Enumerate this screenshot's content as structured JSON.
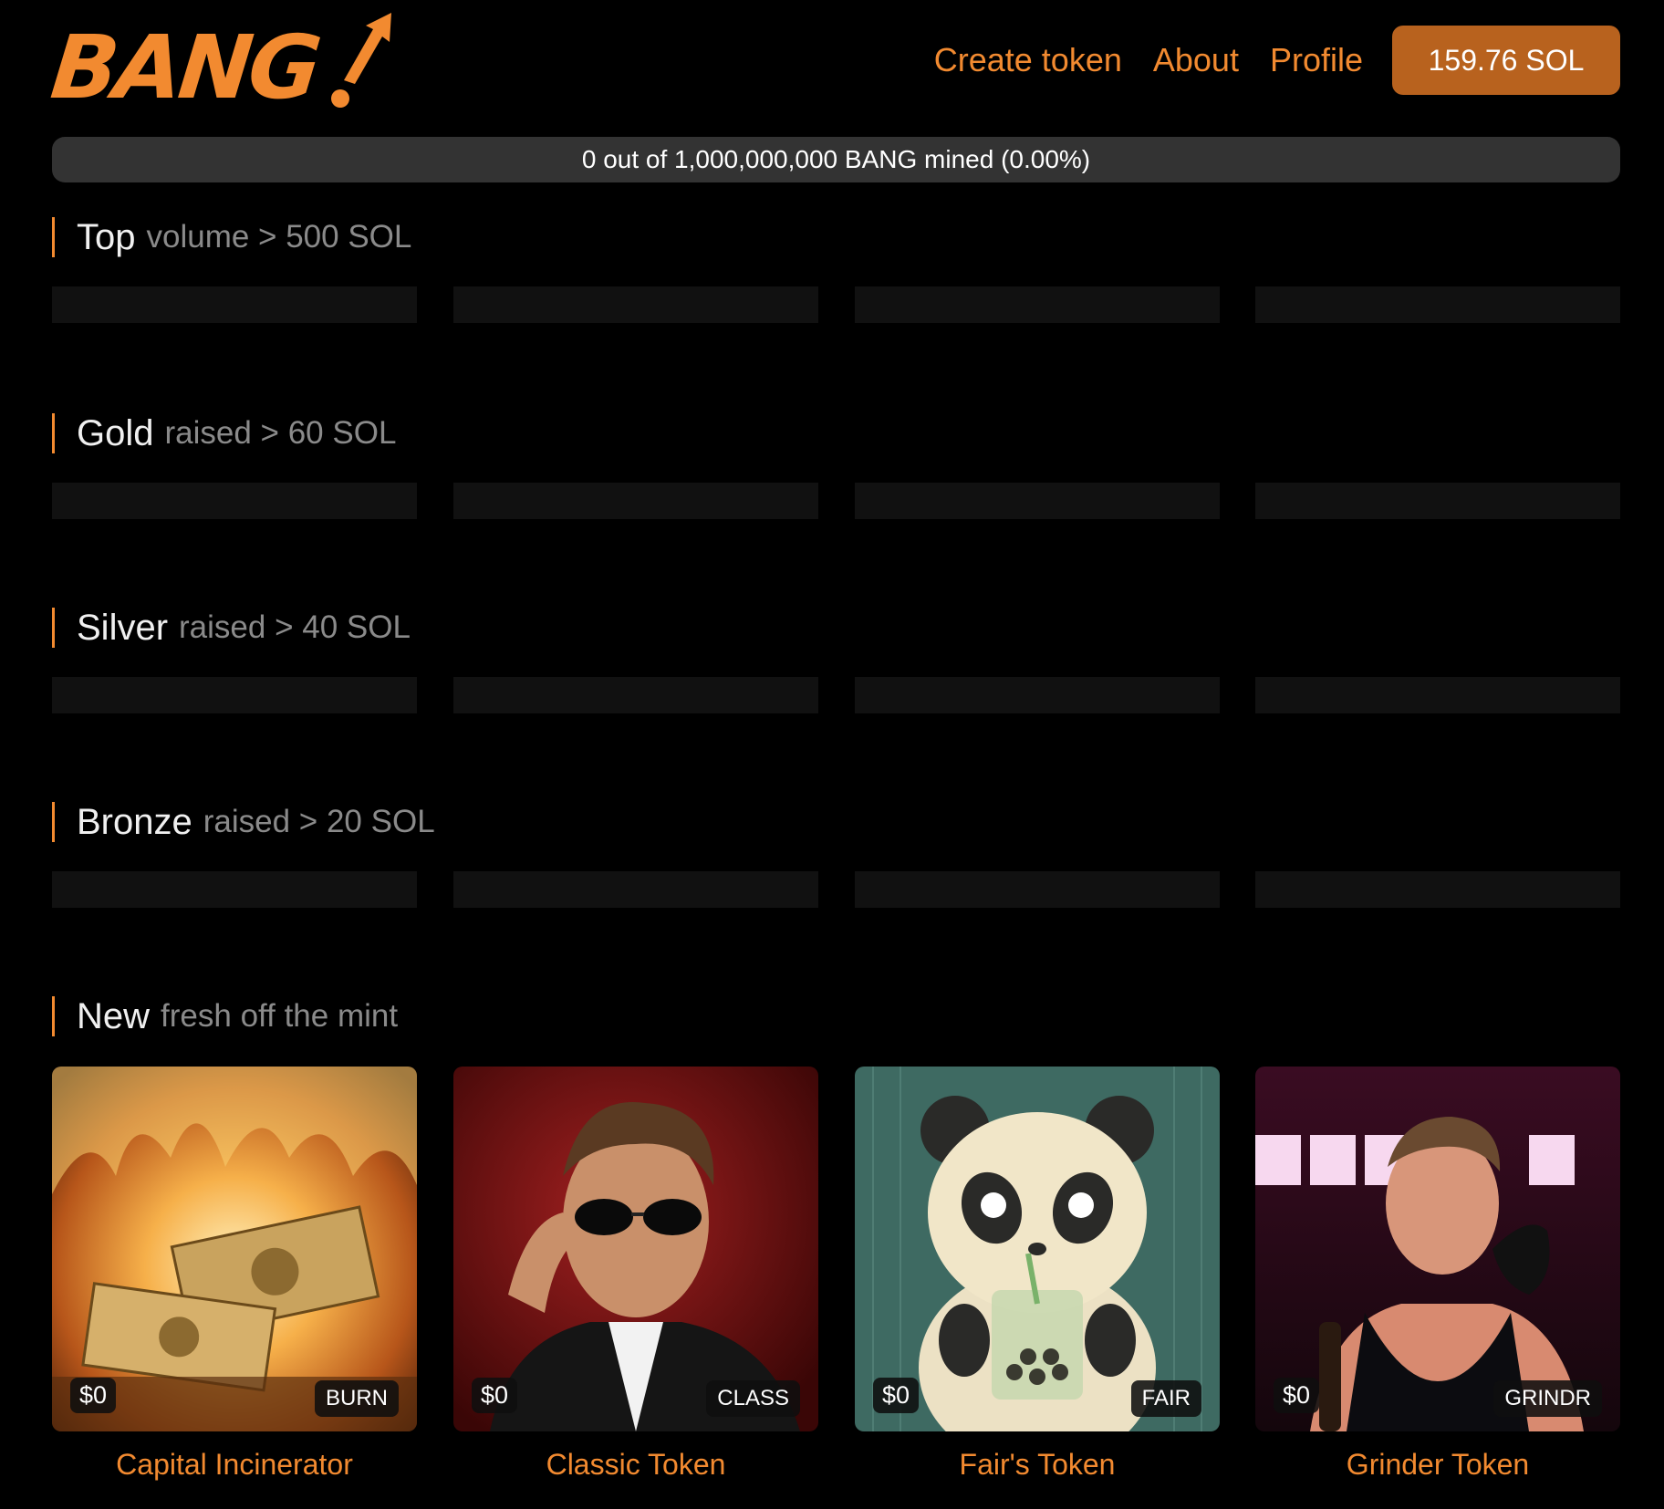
{
  "header": {
    "logo_text": "BANG",
    "nav": [
      {
        "label": "Create token"
      },
      {
        "label": "About"
      },
      {
        "label": "Profile"
      }
    ],
    "balance": "159.76 SOL"
  },
  "mining": {
    "text": "0 out of 1,000,000,000 BANG mined (0.00%)",
    "progress_percent": 0
  },
  "sections": [
    {
      "title": "Top",
      "subtitle": "volume > 500 SOL"
    },
    {
      "title": "Gold",
      "subtitle": "raised > 60 SOL"
    },
    {
      "title": "Silver",
      "subtitle": "raised > 40 SOL"
    },
    {
      "title": "Bronze",
      "subtitle": "raised > 20 SOL"
    },
    {
      "title": "New",
      "subtitle": "fresh off the mint"
    }
  ],
  "new_tokens": [
    {
      "name": "Capital Incinerator",
      "price": "$0",
      "ticker": "BURN",
      "image": "burning-money"
    },
    {
      "name": "Classic Token",
      "price": "$0",
      "ticker": "CLASS",
      "image": "man-sunglasses"
    },
    {
      "name": "Fair's Token",
      "price": "$0",
      "ticker": "FAIR",
      "image": "panda-boba"
    },
    {
      "name": "Grinder Token",
      "price": "$0",
      "ticker": "GRINDR",
      "image": "man-neon-bar"
    }
  ],
  "colors": {
    "accent": "#f28a30",
    "button": "#b8621e",
    "background": "#000000",
    "placeholder": "#111111"
  }
}
